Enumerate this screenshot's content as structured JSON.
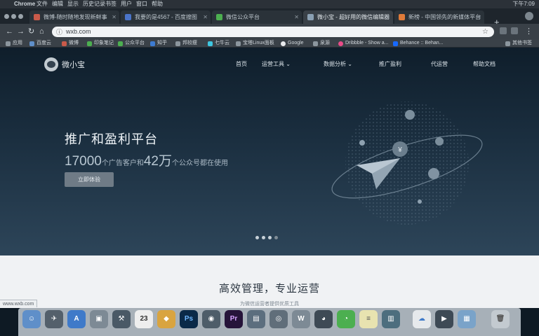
{
  "menubar": {
    "apple": "",
    "items": [
      "Chrome",
      "文件",
      "编辑",
      "显示",
      "历史记录",
      "书签",
      "用户",
      "窗口",
      "帮助"
    ],
    "clock": "下午7:09"
  },
  "tabs": [
    {
      "title": "微博-随时随地发现新鲜事"
    },
    {
      "title": "我要的是4567 - 百度搜图"
    },
    {
      "title": "微信公众平台"
    },
    {
      "title": "微小宝 - 超好用的微信编辑器",
      "active": true
    },
    {
      "title": "新榜 - 中国领先的新媒体平台"
    }
  ],
  "address": {
    "url": "wxb.com"
  },
  "bookmarks": [
    "应用",
    "百度云",
    "微博",
    "印象笔记",
    "公众平台",
    "知乎",
    "邦较瘦",
    "七牛云",
    "宝塔Linux面板",
    "Google",
    "泉源",
    "Dribbble - Show a...",
    "Behance :: Behan..."
  ],
  "other_bookmarks": "其他书签",
  "hero": {
    "brand": "微小宝",
    "nav": [
      "首页",
      "运营工具",
      "数据分析",
      "推广盈利",
      "代运营",
      "帮助文档"
    ],
    "title": "推广和盈利平台",
    "sub_prefix": "17000",
    "sub_mid1": "个广告客户和",
    "sub_num2": "42万",
    "sub_suffix": "个公众号都在使用",
    "button": "立即体验"
  },
  "section": {
    "title": "高效管理，专业运营",
    "subtitle": "为微信运营者提供优质工具"
  },
  "status_url": "www.wxb.com",
  "dock_date": "23",
  "colors": {
    "accent": "#6f7b86",
    "hero_top": "#0f1e2b",
    "hero_bottom": "#2d4559"
  }
}
